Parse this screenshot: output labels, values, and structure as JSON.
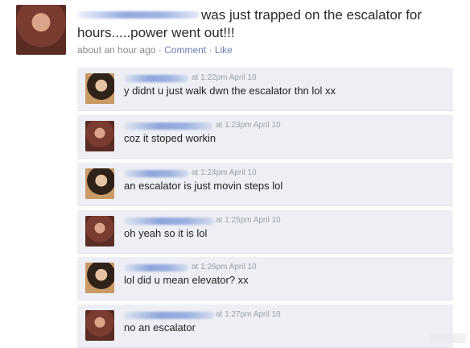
{
  "status": {
    "line1": "was just trapped on the escalator for",
    "line2": "hours.....power went out!!!",
    "time": "about an hour ago",
    "sep1": "·",
    "comment_link": "Comment",
    "sep2": "·",
    "like_link": "Like"
  },
  "comments": [
    {
      "timestamp": "at 1:22pm April 10",
      "text": "y didnt u just walk dwn the escalator thn lol xx"
    },
    {
      "timestamp": "at 1:23pm April 10",
      "text": "coz it stoped workin"
    },
    {
      "timestamp": "at 1:24pm April 10",
      "text": "an escalator is just movin steps lol"
    },
    {
      "timestamp": "at 1:25pm April 10",
      "text": "oh yeah so it is lol"
    },
    {
      "timestamp": "at 1:26pm April 10",
      "text": "lol did u mean elevator? xx"
    },
    {
      "timestamp": "at 1:27pm April 10",
      "text": "no an escalator"
    }
  ],
  "colors": {
    "comment_bg": "#edeff4",
    "link": "#6a7fae",
    "name_blur": "#7a96d6"
  }
}
